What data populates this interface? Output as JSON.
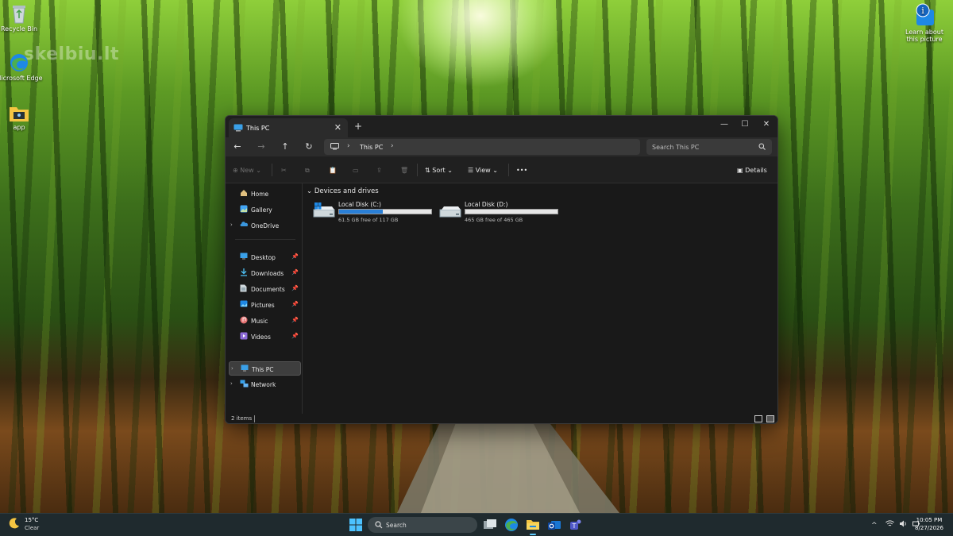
{
  "desktop": {
    "icons": [
      {
        "label": "Recycle Bin"
      },
      {
        "label": "Microsoft Edge"
      },
      {
        "label": "app"
      }
    ],
    "learn_icon_label": "Learn about this picture",
    "watermark": "skelbiu.lt"
  },
  "window": {
    "tab_title": "This PC",
    "new_tab_glyph": "+",
    "controls": {
      "minimize": "—",
      "maximize": "☐",
      "close": "✕"
    },
    "nav": {
      "back": "←",
      "forward": "→",
      "up": "↑",
      "refresh": "↻"
    },
    "breadcrumb": [
      "This PC"
    ],
    "search_placeholder": "Search This PC",
    "commands": {
      "new_label": "New",
      "sort_label": "Sort",
      "view_label": "View",
      "more_label": "•••",
      "details_label": "Details"
    },
    "sidebar": {
      "top": [
        {
          "label": "Home",
          "icon": "home-icon"
        },
        {
          "label": "Gallery",
          "icon": "gallery-icon"
        },
        {
          "label": "OneDrive",
          "icon": "cloud-icon",
          "expandable": true
        }
      ],
      "pinned": [
        {
          "label": "Desktop",
          "icon": "desktop-icon"
        },
        {
          "label": "Downloads",
          "icon": "download-icon"
        },
        {
          "label": "Documents",
          "icon": "document-icon"
        },
        {
          "label": "Pictures",
          "icon": "pictures-icon"
        },
        {
          "label": "Music",
          "icon": "music-icon"
        },
        {
          "label": "Videos",
          "icon": "video-icon"
        }
      ],
      "bottom": [
        {
          "label": "This PC",
          "icon": "pc-icon",
          "selected": true
        },
        {
          "label": "Network",
          "icon": "network-icon"
        }
      ]
    },
    "group_header": "Devices and drives",
    "drives": [
      {
        "name": "Local Disk (C:)",
        "free_text": "61.5 GB free of 117 GB",
        "used_fraction": 0.47
      },
      {
        "name": "Local Disk (D:)",
        "free_text": "465 GB free of 465 GB",
        "used_fraction": 0.0
      }
    ],
    "status": "2 items"
  },
  "taskbar": {
    "weather_temp": "15°C",
    "weather_cond": "Clear",
    "search_label": "Search",
    "time": "10:05 PM",
    "date": "8/27/2026",
    "tray_chevron": "^"
  },
  "colors": {
    "accent": "#2a7fd6",
    "window_bg": "#191919",
    "taskbar_bg": "#1f2a2e"
  }
}
